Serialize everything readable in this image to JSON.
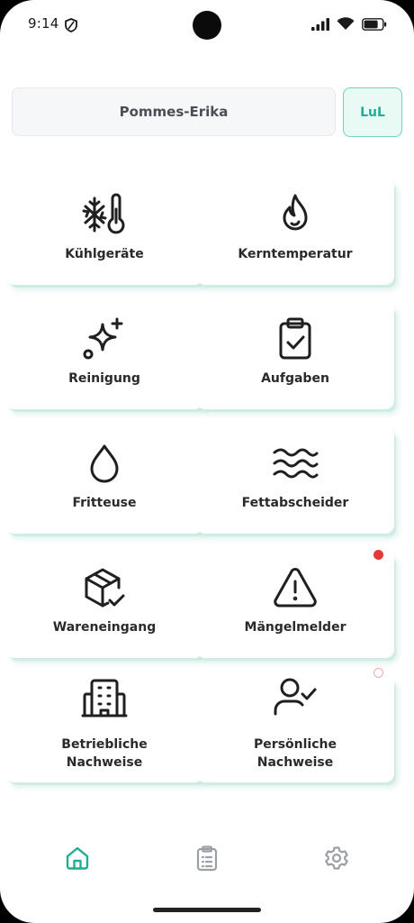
{
  "status_bar": {
    "time": "9:14"
  },
  "header": {
    "user_name": "Pommes-Erika",
    "site_label": "LuL"
  },
  "tiles": [
    {
      "label_lines": [
        "Kühlgeräte"
      ],
      "icon": "snowflake-thermometer-icon"
    },
    {
      "label_lines": [
        "Kerntemperatur"
      ],
      "icon": "flame-icon"
    },
    {
      "label_lines": [
        "Reinigung"
      ],
      "icon": "sparkles-icon"
    },
    {
      "label_lines": [
        "Aufgaben"
      ],
      "icon": "clipboard-check-icon"
    },
    {
      "label_lines": [
        "Fritteuse"
      ],
      "icon": "droplet-icon"
    },
    {
      "label_lines": [
        "Fettabscheider"
      ],
      "icon": "waves-icon"
    },
    {
      "label_lines": [
        "Wareneingang"
      ],
      "icon": "package-check-icon"
    },
    {
      "label_lines": [
        "Mängelmelder"
      ],
      "icon": "warning-triangle-icon"
    },
    {
      "label_lines": [
        "Betriebliche",
        "Nachweise"
      ],
      "icon": "building-icon"
    },
    {
      "label_lines": [
        "Persönliche",
        "Nachweise"
      ],
      "icon": "user-check-icon"
    }
  ],
  "bottom_nav": {
    "items": [
      {
        "id": "home",
        "icon": "home-icon",
        "active": true
      },
      {
        "id": "tasks",
        "icon": "clipboard-list-icon",
        "active": false
      },
      {
        "id": "settings",
        "icon": "gear-icon",
        "active": false
      }
    ]
  },
  "colors": {
    "accent": "#1fae91",
    "icon_inactive": "#9aa0a6",
    "alert_badge": "#e53935"
  }
}
